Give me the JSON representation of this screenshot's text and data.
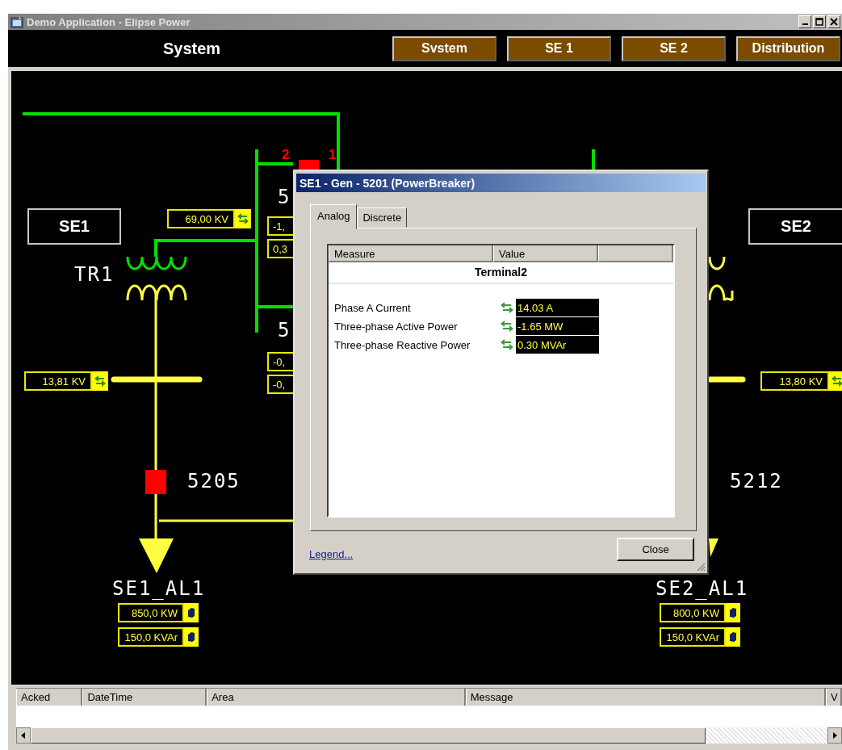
{
  "window": {
    "title": "Demo Application - Elipse Power"
  },
  "header": {
    "title": "System",
    "nav": [
      "Svstem",
      "SE 1",
      "SE 2",
      "Distribution"
    ]
  },
  "diagram": {
    "stations": [
      "SE1",
      "SE2"
    ],
    "labels": [
      {
        "kind": "transformer",
        "text": "TR1"
      },
      {
        "kind": "breaker",
        "text": "5205"
      },
      {
        "kind": "breaker",
        "text": "5212"
      },
      {
        "kind": "load",
        "text": "SE1_AL1"
      },
      {
        "kind": "load",
        "text": "SE2_AL1"
      },
      {
        "kind": "terminal",
        "text": "2"
      },
      {
        "kind": "terminal",
        "text": "1"
      },
      {
        "kind": "breaker",
        "text": "5"
      },
      {
        "kind": "breaker",
        "text": "5"
      }
    ],
    "measurements": [
      {
        "value": "69,00 KV",
        "kind": "remote"
      },
      {
        "value": "13,81 KV",
        "kind": "remote"
      },
      {
        "value": "13,80 KV",
        "kind": "remote"
      },
      {
        "value": "850,0 KW",
        "kind": "manual"
      },
      {
        "value": "150,0 KVAr",
        "kind": "manual"
      },
      {
        "value": "800,0 KW",
        "kind": "manual"
      },
      {
        "value": "150,0 KVAr",
        "kind": "manual"
      },
      {
        "value": "-1,"
      },
      {
        "value": "0,3"
      },
      {
        "value": "-0,"
      },
      {
        "value": "-0,"
      }
    ]
  },
  "dialog": {
    "title": "SE1 - Gen - 5201 (PowerBreaker)",
    "tabs": [
      {
        "label": "Analog",
        "selected": true
      },
      {
        "label": "Discrete",
        "selected": false
      }
    ],
    "columns": [
      "Measure",
      "Value"
    ],
    "group": "Terminal2",
    "rows": [
      {
        "measure": "Phase A Current",
        "value": "14.03 A"
      },
      {
        "measure": "Three-phase Active Power",
        "value": "-1.65 MW"
      },
      {
        "measure": "Three-phase Reactive Power",
        "value": "0.30 MVAr"
      }
    ],
    "link": "Legend...",
    "button": "Close"
  },
  "alarms": {
    "columns": [
      "Acked",
      "DateTime",
      "Area",
      "Message",
      "V"
    ]
  }
}
